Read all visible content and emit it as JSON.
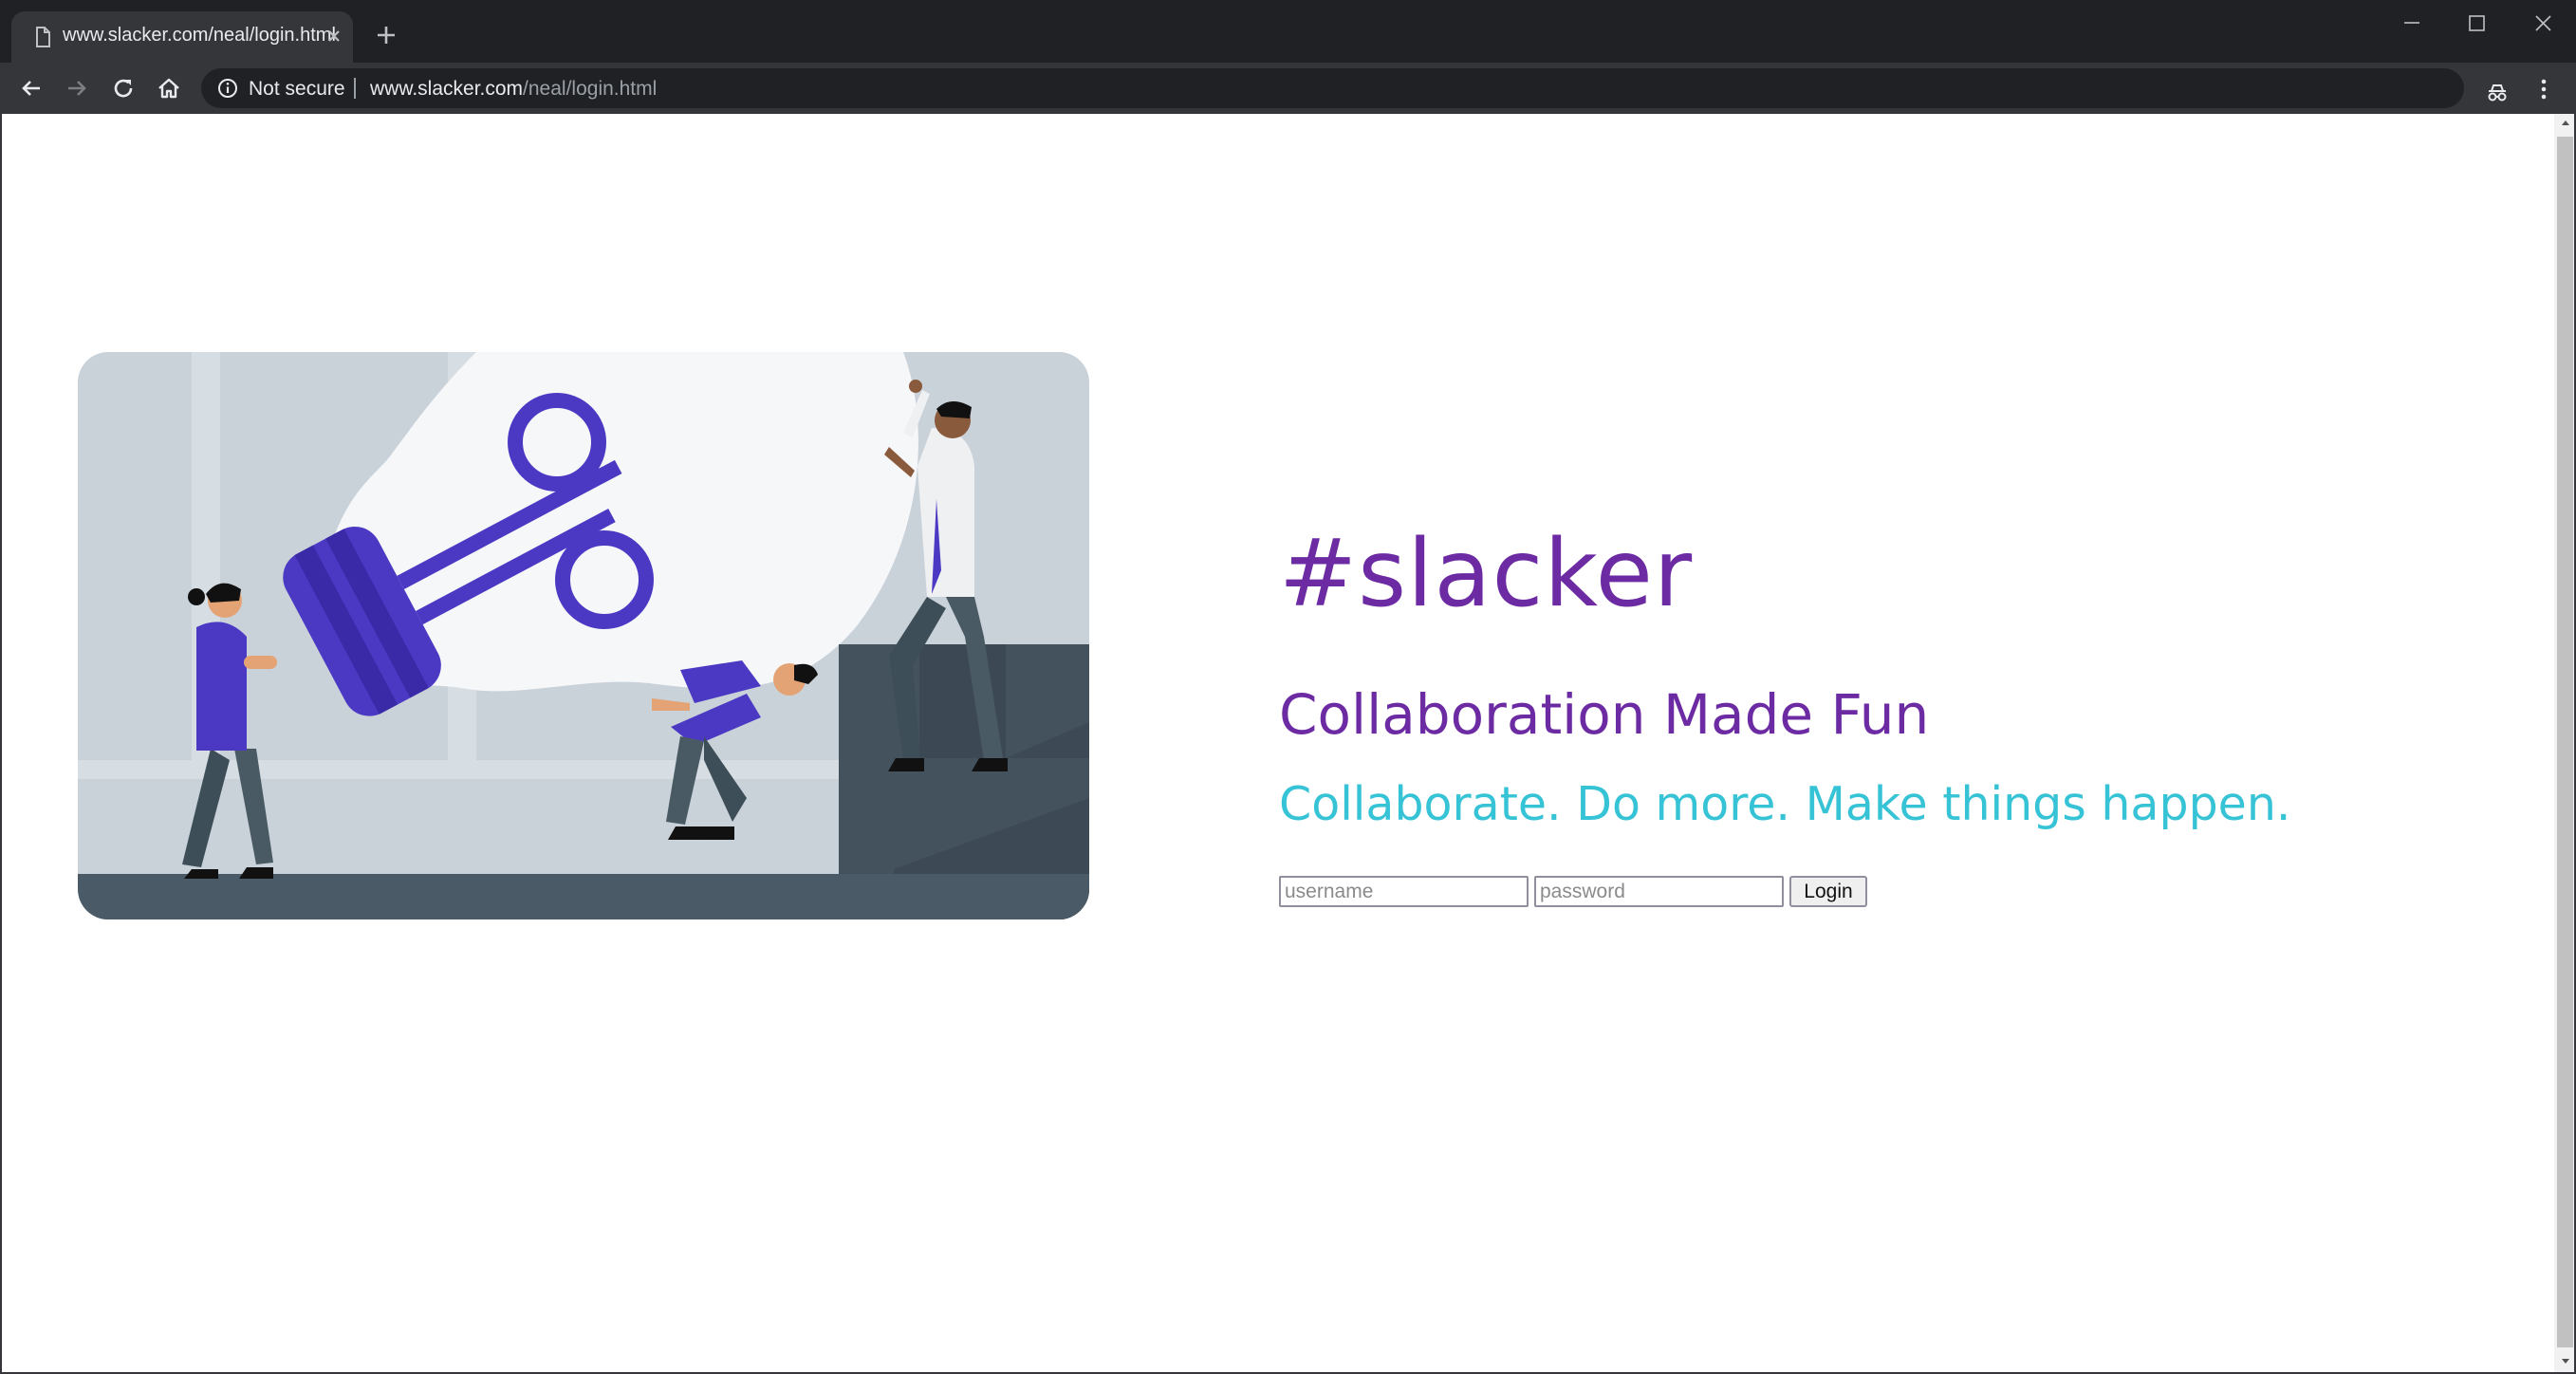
{
  "browser": {
    "tab": {
      "title": "www.slacker.com/neal/login.html"
    },
    "omnibox": {
      "security_label": "Not secure",
      "url_host": "www.slacker.com",
      "url_path": "/neal/login.html"
    }
  },
  "page": {
    "brand": "#slacker",
    "tagline": "Collaboration Made Fun",
    "subline": "Collaborate. Do more. Make things happen.",
    "login": {
      "username_placeholder": "username",
      "password_placeholder": "password",
      "button_label": "Login"
    }
  },
  "colors": {
    "chrome_dark": "#202124",
    "chrome_toolbar": "#35363a",
    "brand_purple": "#6c2ba3",
    "accent_cyan": "#36c3d6",
    "illustration_purple": "#4b39c4",
    "illustration_slate": "#44525e"
  },
  "icons": [
    "page-icon",
    "close-icon",
    "plus-icon",
    "minimize-icon",
    "maximize-icon",
    "window-close-icon",
    "back-arrow-icon",
    "forward-arrow-icon",
    "reload-icon",
    "home-icon",
    "info-icon",
    "star-icon",
    "extension-icon",
    "kebab-menu-icon"
  ]
}
